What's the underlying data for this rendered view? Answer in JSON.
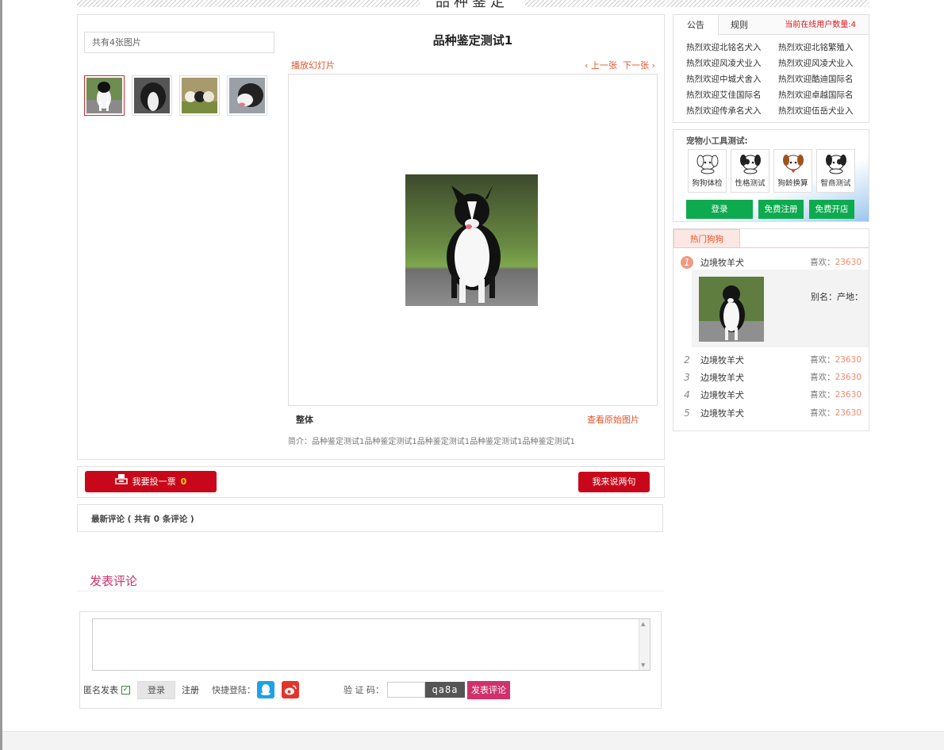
{
  "page": {
    "banner_title": "品种鉴定"
  },
  "gallery": {
    "count_text": "共有4张图片",
    "title": "品种鉴定测试1",
    "slideshow_label": "播放幻灯片",
    "prev_label": "‹ 上一张",
    "next_label": "下一张 ›",
    "section_label": "整体",
    "view_original_label": "查看原始图片",
    "intro": "简介：品种鉴定测试1品种鉴定测试1品种鉴定测试1品种鉴定测试1品种鉴定测试1"
  },
  "vote": {
    "button_label": "我要投一票",
    "count": "0",
    "comment_button_label": "我来说两句"
  },
  "comments": {
    "latest_label": "最新评论 ( 共有",
    "count": "0",
    "suffix": "条评论 )"
  },
  "post_comment": {
    "heading": "发表评论",
    "anonymous_label": "匿名发表",
    "login_label": "登录",
    "register_label": "注册",
    "quick_login_label": "快捷登陆：",
    "captcha_label": "验 证 码：",
    "captcha_text": "qa8a",
    "submit_label": "发表评论"
  },
  "sidebar": {
    "tabs": [
      {
        "label": "公告"
      },
      {
        "label": "规则"
      }
    ],
    "online_text": "当前在线用户数量:4",
    "notices": [
      "热烈欢迎北铭名犬入",
      "热烈欢迎北铭繁殖入",
      "热烈欢迎风凌犬业入",
      "热烈欢迎风凌犬业入",
      "热烈欢迎中城犬舍入",
      "热烈欢迎酷迪国际名",
      "热烈欢迎艾佳国际名",
      "热烈欢迎卓越国际名",
      "热烈欢迎传承名犬入",
      "热烈欢迎伍岳犬业入"
    ],
    "tools_title": "宠物小工具测试:",
    "tools": [
      {
        "label": "狗狗体检",
        "icon": "puppy-checkup-icon"
      },
      {
        "label": "性格测试",
        "icon": "puppy-personality-icon"
      },
      {
        "label": "狗龄换算",
        "icon": "puppy-age-icon"
      },
      {
        "label": "智商测试",
        "icon": "puppy-iq-icon"
      }
    ],
    "login_button": "登录",
    "register_button": "免费注册",
    "open_shop_button": "免费开店",
    "hot_tab": "热门狗狗",
    "like_label": "喜欢：",
    "hot_dogs": [
      {
        "rank": "1",
        "name": "边境牧羊犬",
        "likes": "23630"
      },
      {
        "rank": "2",
        "name": "边境牧羊犬",
        "likes": "23630"
      },
      {
        "rank": "3",
        "name": "边境牧羊犬",
        "likes": "23630"
      },
      {
        "rank": "4",
        "name": "边境牧羊犬",
        "likes": "23630"
      },
      {
        "rank": "5",
        "name": "边境牧羊犬",
        "likes": "23630"
      }
    ],
    "hot_detail_alias": "别名：产地："
  },
  "colors": {
    "accent_red": "#c8081a",
    "accent_pink": "#d0316a",
    "link_orange": "#e5542a",
    "accent_green": "#0eaa4f"
  }
}
